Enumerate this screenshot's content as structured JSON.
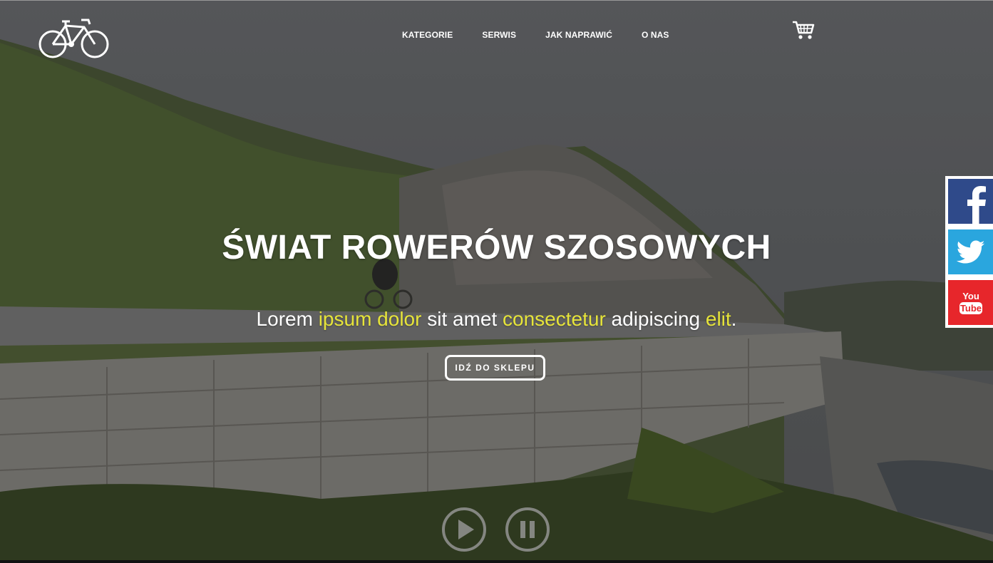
{
  "header": {
    "nav": [
      "KATEGORIE",
      "SERWIS",
      "JAK NAPRAWIĆ",
      "O NAS"
    ]
  },
  "hero": {
    "title": "ŚWIAT ROWERÓW SZOSOWYCH",
    "subtitle_parts": [
      {
        "text": "Lorem ",
        "highlight": false
      },
      {
        "text": "ipsum dolor",
        "highlight": true
      },
      {
        "text": " sit amet ",
        "highlight": false
      },
      {
        "text": "consectetur",
        "highlight": true
      },
      {
        "text": " adipiscing ",
        "highlight": false
      },
      {
        "text": "elit",
        "highlight": true
      },
      {
        "text": ".",
        "highlight": false
      }
    ],
    "cta_label": "IDŹ DO SKLEPU"
  },
  "colors": {
    "highlight": "#e6e43a",
    "facebook": "#2f4a8a",
    "twitter": "#2aa6de",
    "youtube": "#e7262b"
  },
  "icons": {
    "logo": "bicycle-icon",
    "cart": "cart-icon",
    "play": "play-icon",
    "pause": "pause-icon",
    "social": [
      "facebook-icon",
      "twitter-icon",
      "youtube-icon"
    ]
  },
  "social": {
    "youtube_logo_text": [
      "You",
      "Tube"
    ]
  }
}
